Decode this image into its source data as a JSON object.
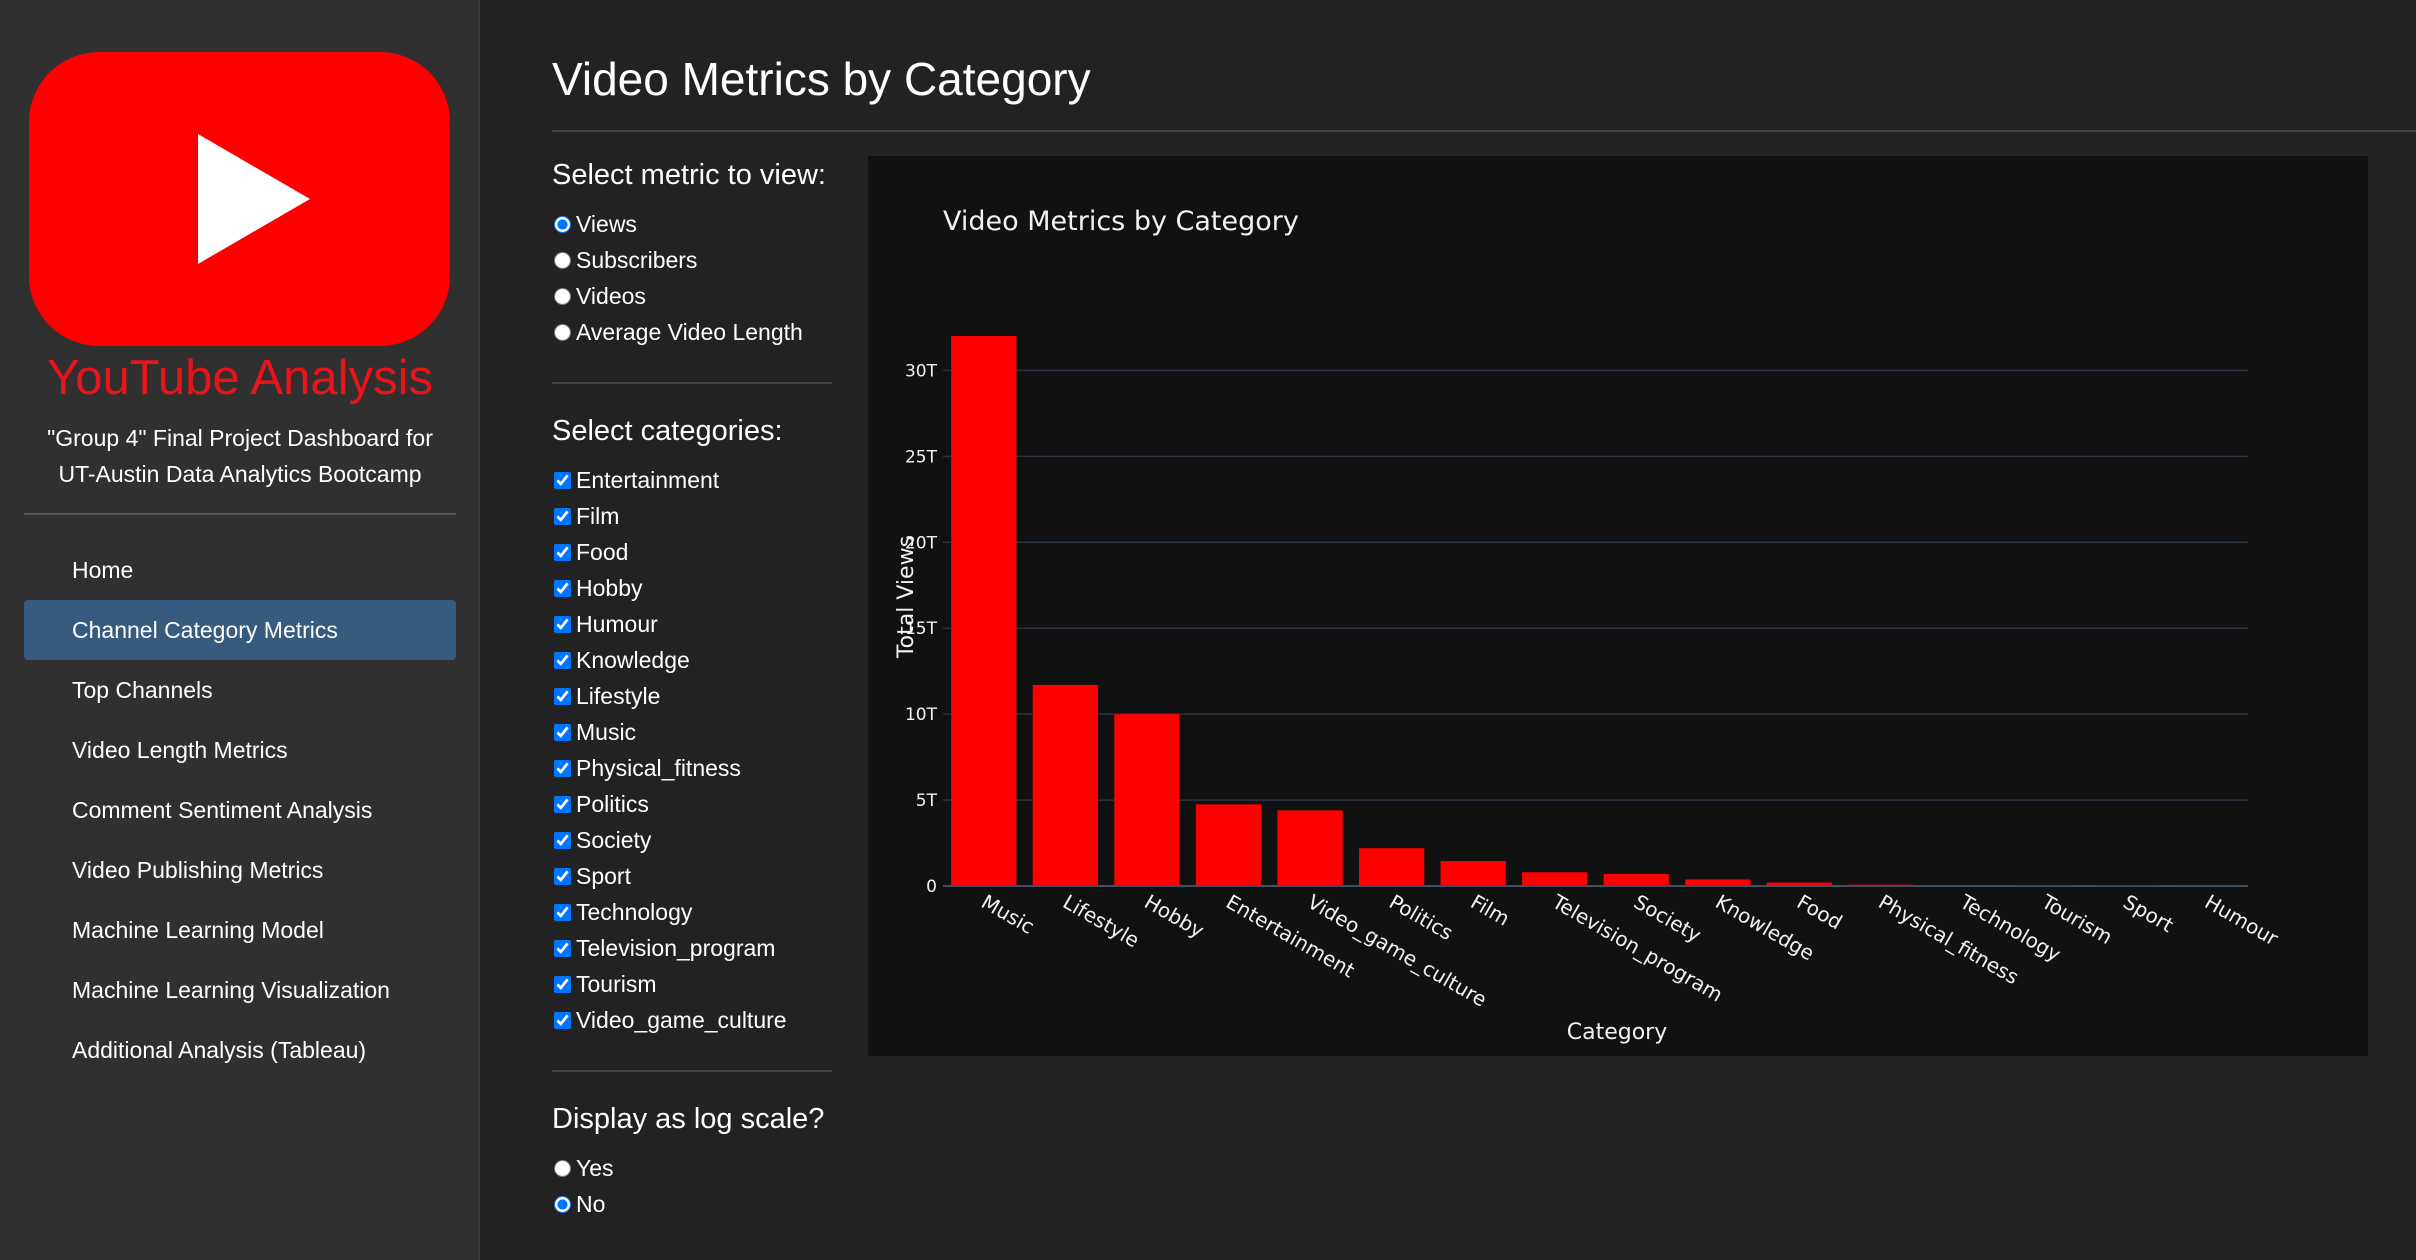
{
  "sidebar": {
    "brand_title": "YouTube Analysis",
    "subtitle_line1": "\"Group 4\" Final Project Dashboard for",
    "subtitle_line2": "UT-Austin Data Analytics Bootcamp",
    "nav": [
      {
        "label": "Home",
        "active": false
      },
      {
        "label": "Channel Category Metrics",
        "active": true
      },
      {
        "label": "Top Channels",
        "active": false
      },
      {
        "label": "Video Length Metrics",
        "active": false
      },
      {
        "label": "Comment Sentiment Analysis",
        "active": false
      },
      {
        "label": "Video Publishing Metrics",
        "active": false
      },
      {
        "label": "Machine Learning Model",
        "active": false
      },
      {
        "label": "Machine Learning Visualization",
        "active": false
      },
      {
        "label": "Additional Analysis (Tableau)",
        "active": false
      }
    ]
  },
  "main": {
    "title": "Video Metrics by Category",
    "metric": {
      "heading": "Select metric to view:",
      "options": [
        {
          "label": "Views",
          "checked": true
        },
        {
          "label": "Subscribers",
          "checked": false
        },
        {
          "label": "Videos",
          "checked": false
        },
        {
          "label": "Average Video Length",
          "checked": false
        }
      ]
    },
    "categories": {
      "heading": "Select categories:",
      "options": [
        {
          "label": "Entertainment",
          "checked": true
        },
        {
          "label": "Film",
          "checked": true
        },
        {
          "label": "Food",
          "checked": true
        },
        {
          "label": "Hobby",
          "checked": true
        },
        {
          "label": "Humour",
          "checked": true
        },
        {
          "label": "Knowledge",
          "checked": true
        },
        {
          "label": "Lifestyle",
          "checked": true
        },
        {
          "label": "Music",
          "checked": true
        },
        {
          "label": "Physical_fitness",
          "checked": true
        },
        {
          "label": "Politics",
          "checked": true
        },
        {
          "label": "Society",
          "checked": true
        },
        {
          "label": "Sport",
          "checked": true
        },
        {
          "label": "Technology",
          "checked": true
        },
        {
          "label": "Television_program",
          "checked": true
        },
        {
          "label": "Tourism",
          "checked": true
        },
        {
          "label": "Video_game_culture",
          "checked": true
        }
      ]
    },
    "log_scale": {
      "heading": "Display as log scale?",
      "options": [
        {
          "label": "Yes",
          "checked": false
        },
        {
          "label": "No",
          "checked": true
        }
      ]
    }
  },
  "colors": {
    "accent": "#375a7f",
    "bar": "#ff0000",
    "brand": "#e8141a"
  },
  "chart_data": {
    "type": "bar",
    "title": "Video Metrics by Category",
    "xlabel": "Category",
    "ylabel": "Total Views",
    "categories": [
      "Music",
      "Lifestyle",
      "Hobby",
      "Entertainment",
      "Video_game_culture",
      "Politics",
      "Film",
      "Television_program",
      "Society",
      "Knowledge",
      "Food",
      "Physical_fitness",
      "Technology",
      "Tourism",
      "Sport",
      "Humour"
    ],
    "values": [
      32.0,
      11.7,
      10.0,
      4.75,
      4.4,
      2.2,
      1.45,
      0.8,
      0.7,
      0.38,
      0.2,
      0.08,
      0.05,
      0.04,
      0.03,
      0.02
    ],
    "units": "T",
    "ylim": [
      0,
      32
    ],
    "yticks": [
      0,
      5,
      10,
      15,
      20,
      25,
      30
    ],
    "ytick_labels": [
      "0",
      "5T",
      "10T",
      "15T",
      "20T",
      "25T",
      "30T"
    ],
    "grid": true,
    "legend": "none"
  }
}
